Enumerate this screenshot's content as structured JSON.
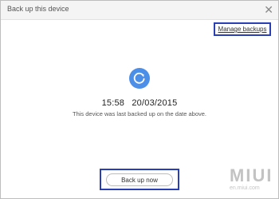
{
  "window": {
    "title": "Back up this device",
    "close_glyph": "✕"
  },
  "header": {
    "manage_backups_label": "Manage backups"
  },
  "status": {
    "icon": "sync-icon",
    "icon_color": "#4b8fe8",
    "time": "15:58",
    "date": "20/03/2015",
    "message": "This device was last backed up on the date above."
  },
  "footer": {
    "backup_button_label": "Back up now"
  },
  "watermark": {
    "main": "MIUI",
    "sub": "en.miui.com"
  },
  "colors": {
    "highlight_box": "#2a3fb5"
  }
}
